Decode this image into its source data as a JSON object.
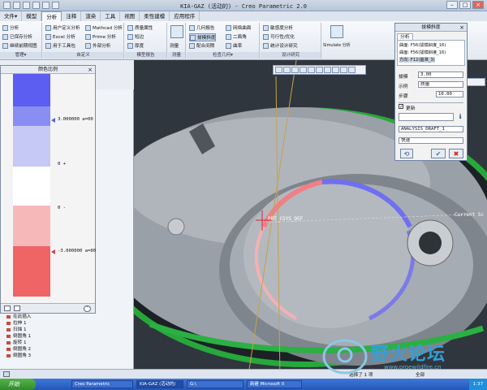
{
  "window": {
    "title": "KIA-GAZ (活动的) - Creo Parametric 2.0"
  },
  "menu_tabs": [
    "文件▾",
    "模型",
    "分析",
    "注释",
    "渲染",
    "工具",
    "视图",
    "柔性建模",
    "应用程序"
  ],
  "ribbon": {
    "manage": {
      "items": [
        "分析",
        "已保存分析",
        "继续前期视图"
      ],
      "caption": "管理▾"
    },
    "custom": {
      "items": [
        "用户定义分析",
        "Excel 分析",
        "用于工具包",
        "Mathcad 分析",
        "Prime 分析",
        "外部分析"
      ],
      "caption": "自定义"
    },
    "model_report": {
      "items": [
        "质量属性",
        "短边",
        "厚度"
      ],
      "caption": "模型报告"
    },
    "measure": {
      "label": "测量",
      "caption": "测量"
    },
    "inspect_geometry": {
      "items": [
        "几何报告",
        "拔模斜度",
        "配合间隙",
        "网络曲面",
        "二面角",
        "曲率"
      ],
      "caption": "检查几何▾"
    },
    "design_study": {
      "items": [
        "敏感度分析",
        "可行性/优化",
        "统计设计研究"
      ],
      "sub_label": "Simulate 分析",
      "caption": "设计研究"
    }
  },
  "scale_dialog": {
    "title": "颜色比例",
    "labels": [
      "3.000000  a=00",
      "0 +",
      "0 -",
      "-3.000000  a=00"
    ]
  },
  "tree": {
    "items": [
      "在此插入",
      "拉伸 1",
      "扫描 1",
      "倒圆角 1",
      "旋转 1",
      "倒圆角 2",
      "倒圆角 3"
    ]
  },
  "graphics": {
    "csys_label": "PRT_CSYS_DEF",
    "current_label": "Current Sc"
  },
  "draft_dialog": {
    "title": "拔模斜度",
    "tab": "分析",
    "refs": [
      "曲面: F56(拔模斜度_16)",
      "曲面: F56(拔模斜度_16)",
      "方向: F12(基准_3)"
    ],
    "label_draft": "拔模",
    "draft_value": "3.00",
    "label_sample": "示例",
    "sample_value": "质量",
    "label_step": "步骤",
    "step_value": "10.00",
    "update_label": "更新",
    "result_value": "ANALYSIS_DRAFT_1",
    "mode_value": "快速",
    "ok_symbol": "✔",
    "cancel_symbol": "✖"
  },
  "status_bar": {
    "left": "选择了 1 项",
    "right": "全部"
  },
  "taskbar": {
    "start": "开始",
    "tasks": [
      "Creo Parametric",
      "KIA-GAZ (活动的)",
      "G:\\",
      "新建 Microsoft 0"
    ],
    "tray": "1:37"
  },
  "watermark": {
    "text": "野火论坛",
    "url": "www.proewildfire.cn"
  },
  "colors": {
    "scale_top": "#5a5cf0",
    "scale_bottom": "#ef6464",
    "ring_green": "#1fae3c",
    "model_gray": "#a8adb4"
  }
}
